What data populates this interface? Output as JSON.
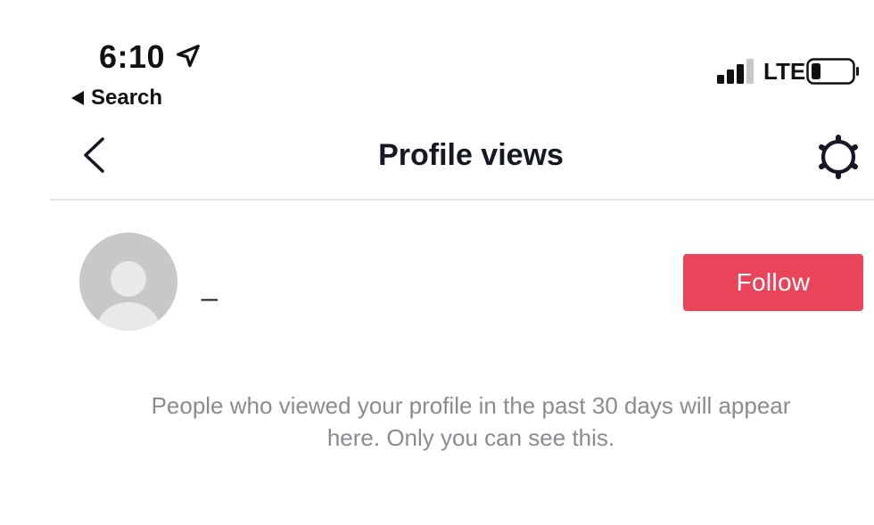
{
  "status_bar": {
    "time": "6:10",
    "back_app_label": "Search",
    "network": "LTE",
    "location_icon": "location-arrow-icon",
    "signal_icon": "cellular-signal-icon",
    "battery_icon": "battery-icon",
    "signal_bars_active": 3,
    "signal_bars_total": 4,
    "battery_level": 0.2
  },
  "nav": {
    "title": "Profile views",
    "back_icon": "chevron-left-icon",
    "settings_icon": "gear-icon"
  },
  "viewer": {
    "username": "_",
    "avatar_icon": "default-avatar-icon",
    "follow_label": "Follow"
  },
  "info": {
    "line1": "People who viewed your profile in the past 30 days will appear",
    "line2": "here. Only you can see this."
  },
  "colors": {
    "accent": "#ea445a",
    "title": "#161823",
    "muted_text": "#8a8b91",
    "divider": "#e3e3e4"
  }
}
